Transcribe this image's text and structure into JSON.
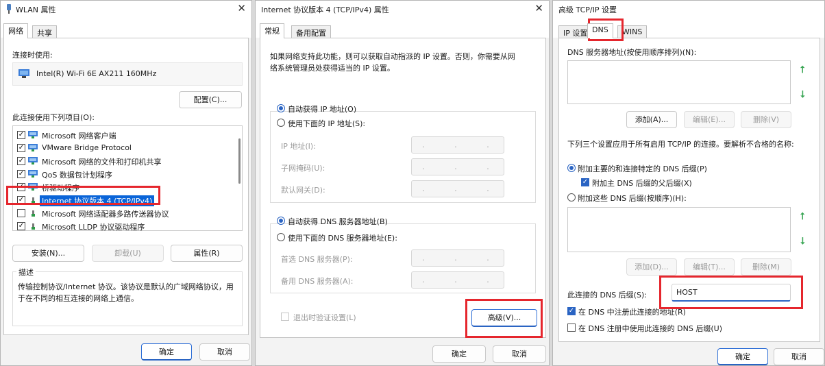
{
  "wlan": {
    "title": "WLAN 属性",
    "tabs": [
      "网络",
      "共享"
    ],
    "connect_using_label": "连接时使用:",
    "adapter_name": "Intel(R) Wi-Fi 6E AX211 160MHz",
    "configure_button": "配置(C)...",
    "items_label": "此连接使用下列项目(O):",
    "items": [
      {
        "label": "Microsoft 网络客户端",
        "checked": true
      },
      {
        "label": "VMware Bridge Protocol",
        "checked": true
      },
      {
        "label": "Microsoft 网络的文件和打印机共享",
        "checked": true
      },
      {
        "label": "QoS 数据包计划程序",
        "checked": true
      },
      {
        "label": "桥驱动程序",
        "checked": true
      },
      {
        "label": "Internet 协议版本 4 (TCP/IPv4)",
        "checked": true,
        "selected": true
      },
      {
        "label": "Microsoft 网络适配器多路传送器协议",
        "checked": false
      },
      {
        "label": "Microsoft LLDP 协议驱动程序",
        "checked": true
      }
    ],
    "install_button": "安装(N)...",
    "uninstall_button": "卸载(U)",
    "properties_button": "属性(R)",
    "description_label": "描述",
    "description_text_1": "传输控制协议/Internet 协议。该协议是默认的广域网络协议，用",
    "description_text_2": "于在不同的相互连接的网络上通信。",
    "ok_button": "确定",
    "cancel_button": "取消"
  },
  "ipv4": {
    "title": "Internet 协议版本 4 (TCP/IPv4) 属性",
    "tabs": [
      "常规",
      "备用配置"
    ],
    "intro_1": "如果网络支持此功能，则可以获取自动指派的 IP 设置。否则，你需要从网",
    "intro_2": "络系统管理员处获得适当的 IP 设置。",
    "auto_ip": "自动获得 IP 地址(O)",
    "manual_ip": "使用下面的 IP 地址(S):",
    "ip_address": "IP 地址(I):",
    "subnet_mask": "子网掩码(U):",
    "default_gateway": "默认网关(D):",
    "ip_placeholder": ". . .",
    "auto_dns": "自动获得 DNS 服务器地址(B)",
    "manual_dns": "使用下面的 DNS 服务器地址(E):",
    "preferred_dns": "首选 DNS 服务器(P):",
    "alternate_dns": "备用 DNS 服务器(A):",
    "validate_on_exit": "退出时验证设置(L)",
    "advanced_button": "高级(V)...",
    "ok_button": "确定",
    "cancel_button": "取消"
  },
  "advanced": {
    "title": "高级 TCP/IP 设置",
    "tabs": [
      "IP 设置",
      "DNS",
      "WINS"
    ],
    "dns_servers_label": "DNS 服务器地址(按使用顺序排列)(N):",
    "add_button": "添加(A)...",
    "edit_button": "编辑(E)...",
    "delete_button": "删除(V)",
    "resolution_label": "下列三个设置应用于所有启用 TCP/IP 的连接。要解析不合格的名称:",
    "append_primary": "附加主要的和连接特定的 DNS 后缀(P)",
    "append_parent": "附加主 DNS 后缀的父后缀(X)",
    "append_these": "附加这些 DNS 后缀(按顺序)(H):",
    "add_button_2": "添加(D)...",
    "edit_button_2": "编辑(T)...",
    "delete_button_2": "删除(M)",
    "connection_suffix_label": "此连接的 DNS 后缀(S):",
    "connection_suffix_value": "HOST",
    "register_dns": "在 DNS 中注册此连接的地址(R)",
    "use_suffix_registration": "在 DNS 注册中使用此连接的 DNS 后缀(U)",
    "ok_button": "确定",
    "cancel_button": "取消"
  },
  "colors": {
    "highlight": "#e5262d",
    "accent": "#2a64c3",
    "selection": "#0a64d8"
  }
}
